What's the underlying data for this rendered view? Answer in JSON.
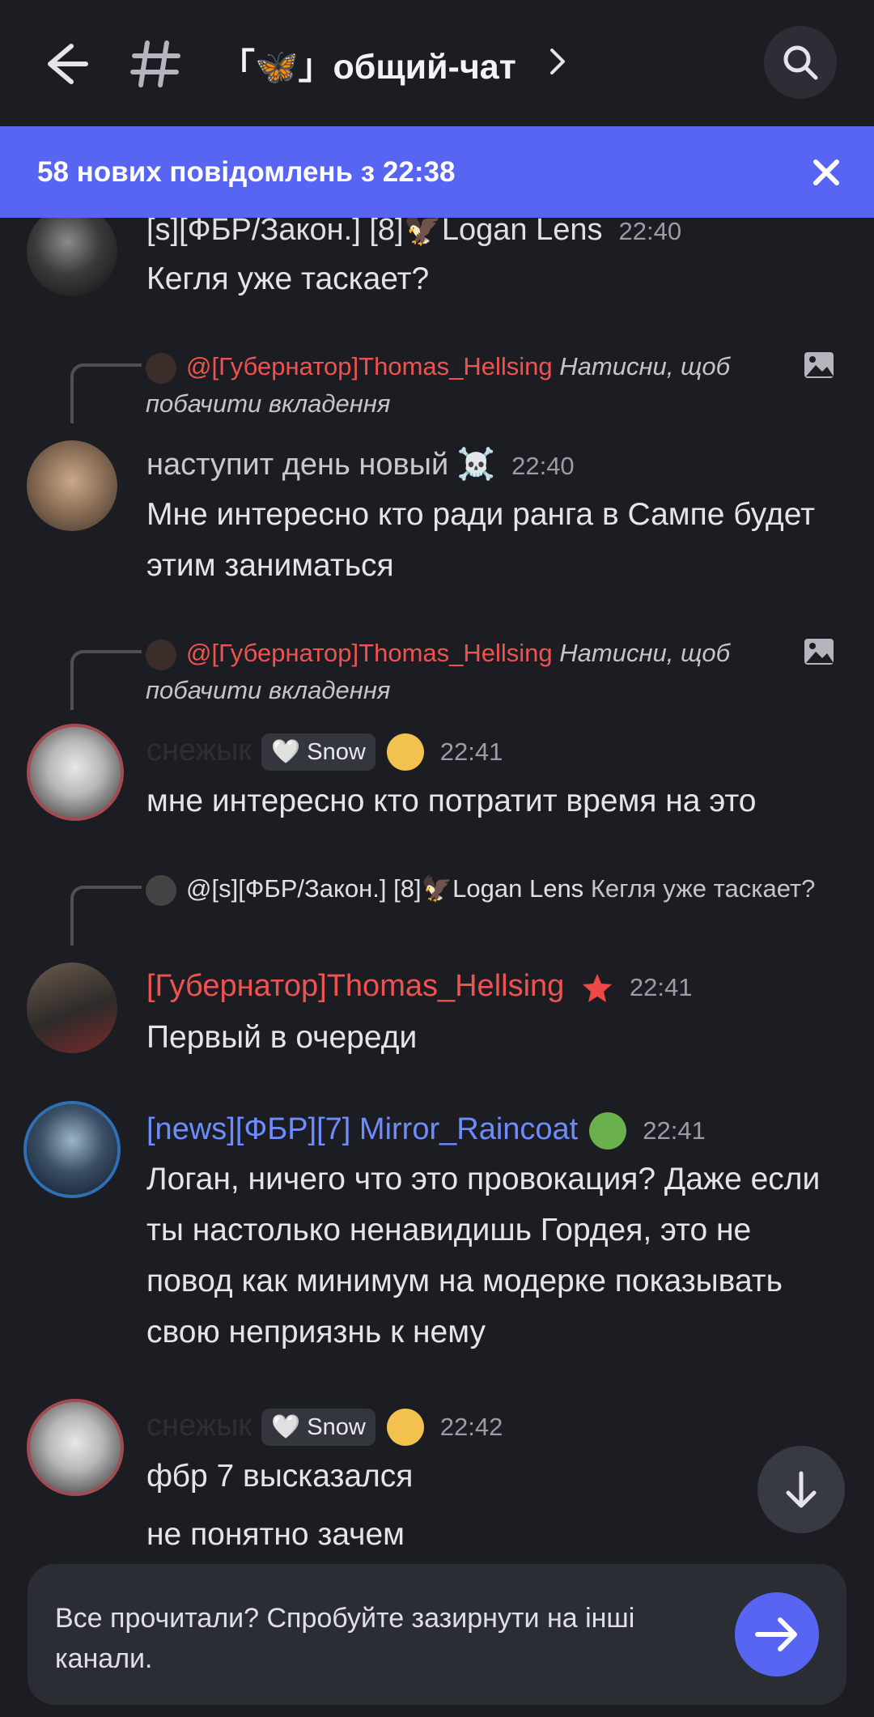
{
  "header": {
    "channel_name": "「🦋」общий-чат"
  },
  "banner": {
    "text": "58 нових повідомлень з 22:38"
  },
  "messages": [
    {
      "author": "[s][ФБР/Закон.] [8]🦅Logan Lens",
      "time": "22:40",
      "text": "Кегля уже таскает?"
    },
    {
      "reply_author": "@[Губернатор]Thomas_Hellsing",
      "reply_text": "Натисни, щоб побачити вкладення",
      "author": "наступит день новый ☠️",
      "time": "22:40",
      "text": "Мне интересно кто ради ранга в Сампе будет этим заниматься"
    },
    {
      "reply_author": "@[Губернатор]Thomas_Hellsing",
      "reply_text": "Натисни, щоб побачити вкладення",
      "author": "снежык",
      "badge": "🤍 Snow",
      "time": "22:41",
      "text": "мне интересно кто потратит время на это"
    },
    {
      "reply_author": "@[s][ФБР/Закон.] [8]🦅Logan Lens",
      "reply_text": "Кегля уже таскает?",
      "author": "[Губернатор]Thomas_Hellsing",
      "time": "22:41",
      "text": "Первый в очереди"
    },
    {
      "author": "[news][ФБР][7] Mirror_Raincoat",
      "time": "22:41",
      "text": "Логан, ничего что это провокация? Даже если ты настолько ненавидишь Гордея, это не повод как минимум на модерке показывать свою неприязнь к нему"
    },
    {
      "author": "снежык",
      "badge": "🤍 Snow",
      "time": "22:42",
      "text": "фбр 7 высказался",
      "text2": "не понятно зачем"
    }
  ],
  "footer": {
    "prompt": "Все прочитали? Спробуйте зазирнути на інші канали."
  },
  "colors": {
    "background": "#1c1d23",
    "accent": "#5865f2",
    "red_name": "#ef5350",
    "blue_name": "#6e8cff"
  }
}
